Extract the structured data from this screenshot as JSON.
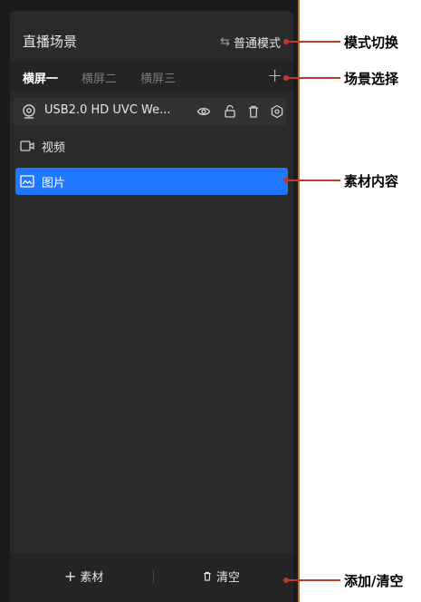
{
  "panel": {
    "title": "直播场景",
    "mode_label": "普通模式",
    "mode_icon": "swap-arrows-icon"
  },
  "tabs": [
    {
      "label": "横屏一",
      "active": true
    },
    {
      "label": "横屏二",
      "active": false
    },
    {
      "label": "横屏三",
      "active": false
    }
  ],
  "tab_add_label": "+",
  "sources": [
    {
      "label": "USB2.0 HD UVC We...",
      "icon": "webcam-icon",
      "type": "camera"
    },
    {
      "label": "视频",
      "icon": "video-icon",
      "type": "video"
    },
    {
      "label": "图片",
      "icon": "image-icon",
      "type": "image",
      "selected": true
    }
  ],
  "footer": {
    "add_label": "素材",
    "clear_label": "清空"
  },
  "annotations": {
    "mode_switch": "模式切换",
    "scene_select": "场景选择",
    "material_content": "素材内容",
    "add_clear": "添加/清空"
  },
  "colors": {
    "accent": "#1f78ff",
    "annotation_line": "#c0392b",
    "frame_border": "#b8762e"
  }
}
